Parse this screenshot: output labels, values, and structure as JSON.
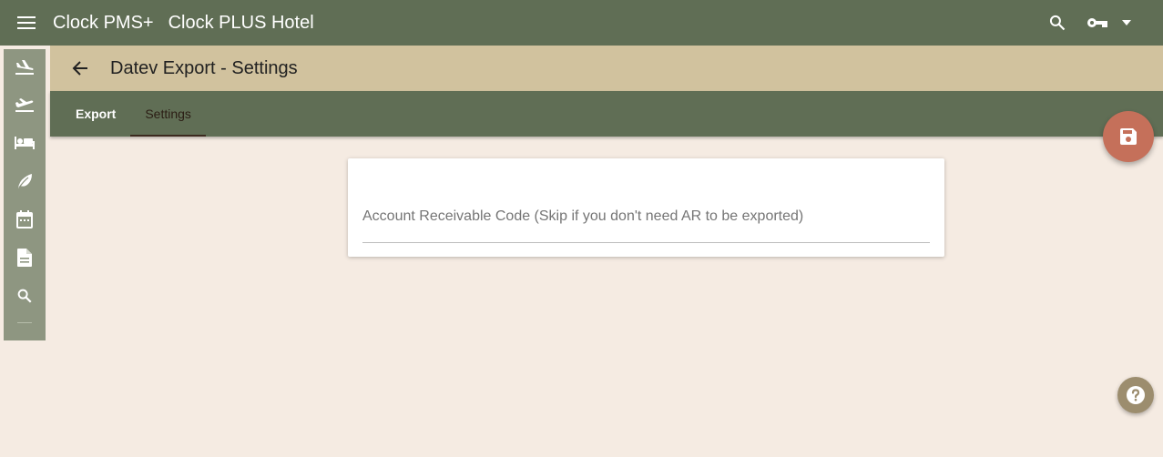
{
  "header": {
    "app_name": "Clock PMS+",
    "hotel_name": "Clock PLUS Hotel",
    "icons": [
      "menu-icon",
      "search-icon",
      "key-icon",
      "caret-down-icon"
    ]
  },
  "sidebar": {
    "items": [
      {
        "name": "arrivals",
        "icon": "flight-land-icon"
      },
      {
        "name": "departures",
        "icon": "flight-takeoff-icon"
      },
      {
        "name": "rooms",
        "icon": "bed-icon"
      },
      {
        "name": "housekeeping",
        "icon": "leaf-icon"
      },
      {
        "name": "calendar",
        "icon": "calendar-icon"
      },
      {
        "name": "documents",
        "icon": "document-icon"
      },
      {
        "name": "search",
        "icon": "search-icon"
      }
    ]
  },
  "page": {
    "title": "Datev Export - Settings"
  },
  "tabs": [
    {
      "label": "Export",
      "active": false
    },
    {
      "label": "Settings",
      "active": true
    }
  ],
  "form": {
    "ar_code_label": "Account Receivable Code (Skip if you don't need AR to be exported)",
    "ar_code_value": ""
  },
  "colors": {
    "topbar": "#606e55",
    "titlebar": "#d1c29e",
    "sidebar": "#8e9681",
    "background": "#f5ebe2",
    "save_fab": "#c5705a",
    "help_fab": "#9c8d6e"
  }
}
